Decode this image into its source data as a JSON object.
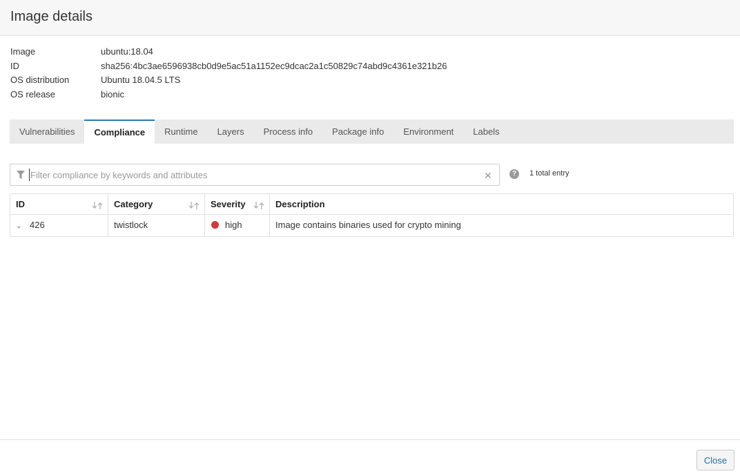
{
  "header": {
    "title": "Image details"
  },
  "details": [
    {
      "label": "Image",
      "value": "ubuntu:18.04"
    },
    {
      "label": "ID",
      "value": "sha256:4bc3ae6596938cb0d9e5ac51a1152ec9dcac2a1c50829c74abd9c4361e321b26"
    },
    {
      "label": "OS distribution",
      "value": "Ubuntu 18.04.5 LTS"
    },
    {
      "label": "OS release",
      "value": "bionic"
    }
  ],
  "tabs": [
    {
      "label": "Vulnerabilities"
    },
    {
      "label": "Compliance",
      "active": true
    },
    {
      "label": "Runtime"
    },
    {
      "label": "Layers"
    },
    {
      "label": "Process info"
    },
    {
      "label": "Package info"
    },
    {
      "label": "Environment"
    },
    {
      "label": "Labels"
    }
  ],
  "filter": {
    "placeholder": "Filter compliance by keywords and attributes",
    "value": ""
  },
  "help": {
    "symbol": "?"
  },
  "total": "1 total entry",
  "table": {
    "columns": [
      {
        "label": "ID",
        "sortable": true
      },
      {
        "label": "Category",
        "sortable": true
      },
      {
        "label": "Severity",
        "sortable": true
      },
      {
        "label": "Description",
        "sortable": false
      }
    ],
    "rows": [
      {
        "id": "426",
        "category": "twistlock",
        "severity": "high",
        "severity_color": "#d9353a",
        "description": "Image contains binaries used for crypto mining"
      }
    ]
  },
  "footer": {
    "close_label": "Close"
  },
  "colors": {
    "accent": "#2a7ab0",
    "link": "#1f6fa8",
    "severity_high": "#d9353a"
  }
}
